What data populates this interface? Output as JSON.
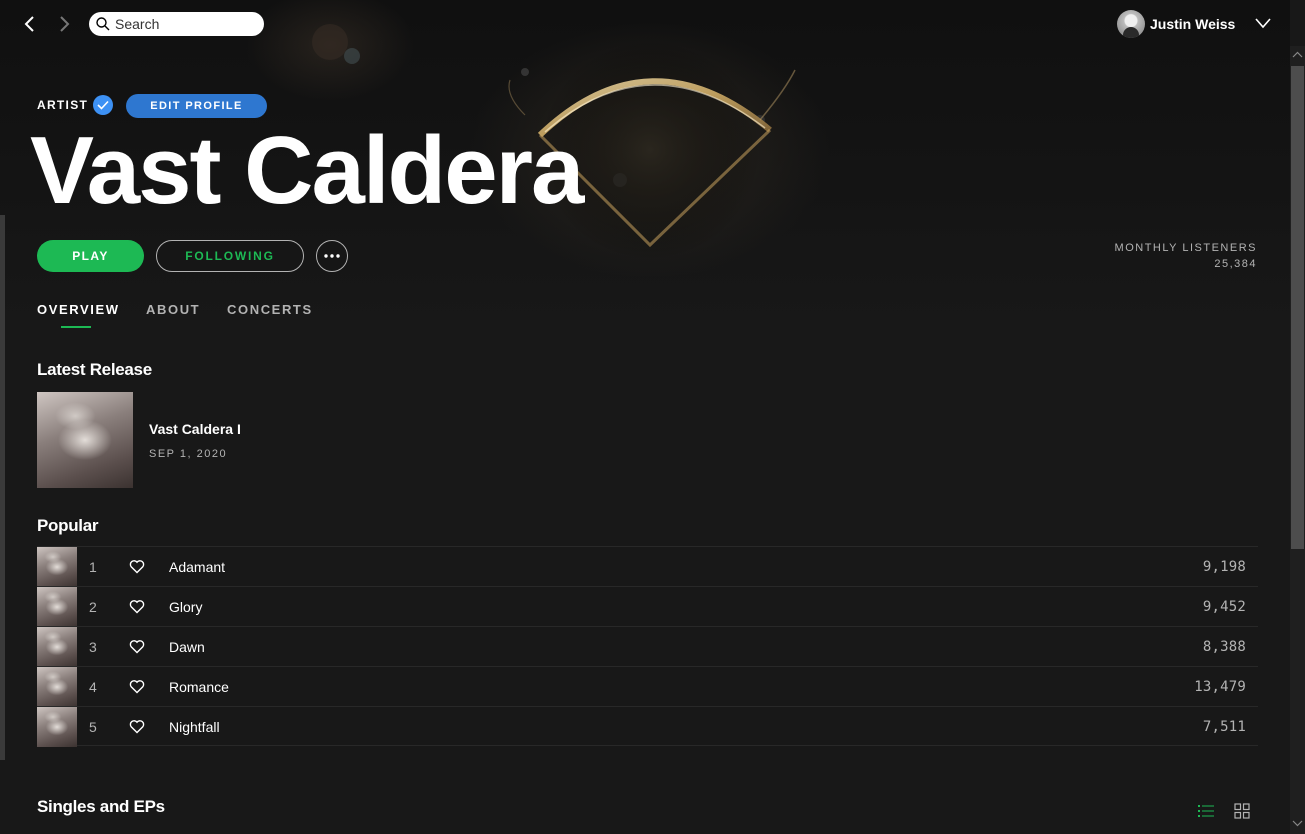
{
  "colors": {
    "accent": "#1db954",
    "verified": "#3d91f4",
    "edit_profile": "#2e77d0",
    "background": "#181818",
    "muted_text": "#b3b3b3"
  },
  "topbar": {
    "search_placeholder": "Search",
    "user_name": "Justin Weiss"
  },
  "artist": {
    "label": "ARTIST",
    "edit_profile_label": "EDIT PROFILE",
    "name": "Vast Caldera",
    "play_label": "PLAY",
    "following_label": "FOLLOWING",
    "monthly_listeners_label": "MONTHLY LISTENERS",
    "monthly_listeners_value": "25,384"
  },
  "tabs": [
    {
      "label": "OVERVIEW",
      "active": true
    },
    {
      "label": "ABOUT",
      "active": false
    },
    {
      "label": "CONCERTS",
      "active": false
    }
  ],
  "latest_release": {
    "heading": "Latest Release",
    "title": "Vast Caldera I",
    "date": "SEP 1, 2020"
  },
  "popular": {
    "heading": "Popular",
    "tracks": [
      {
        "num": "1",
        "title": "Adamant",
        "plays": "9,198"
      },
      {
        "num": "2",
        "title": "Glory",
        "plays": "9,452"
      },
      {
        "num": "3",
        "title": "Dawn",
        "plays": "8,388"
      },
      {
        "num": "4",
        "title": "Romance",
        "plays": "13,479"
      },
      {
        "num": "5",
        "title": "Nightfall",
        "plays": "7,511"
      }
    ]
  },
  "singles": {
    "heading": "Singles and EPs"
  },
  "icons": {
    "back": "chevron-left-icon",
    "forward": "chevron-right-icon",
    "search": "search-icon",
    "verified": "check-badge-icon",
    "more": "ellipsis-icon",
    "heart": "heart-icon",
    "list_view": "list-view-icon",
    "grid_view": "grid-view-icon"
  }
}
